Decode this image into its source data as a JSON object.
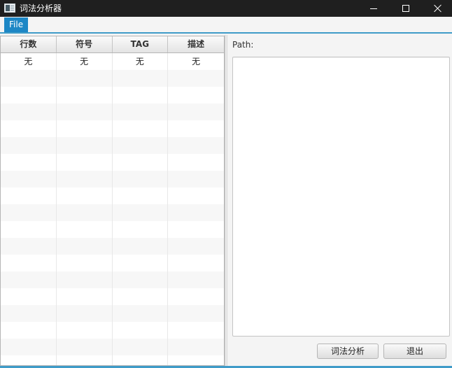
{
  "window": {
    "title": "词法分析器",
    "icon": "app-icon"
  },
  "menu": {
    "items": [
      {
        "label": "File"
      }
    ]
  },
  "table": {
    "columns": [
      "行数",
      "符号",
      "TAG",
      "描述"
    ],
    "rows": [
      [
        "无",
        "无",
        "无",
        "无"
      ]
    ]
  },
  "right_pane": {
    "path_label": "Path:",
    "code_text": ""
  },
  "buttons": {
    "analyze": "词法分析",
    "exit": "退出"
  },
  "colors": {
    "titlebar": "#1f1f1f",
    "menu_active": "#1d87c5",
    "accent": "#3f9bc8"
  }
}
